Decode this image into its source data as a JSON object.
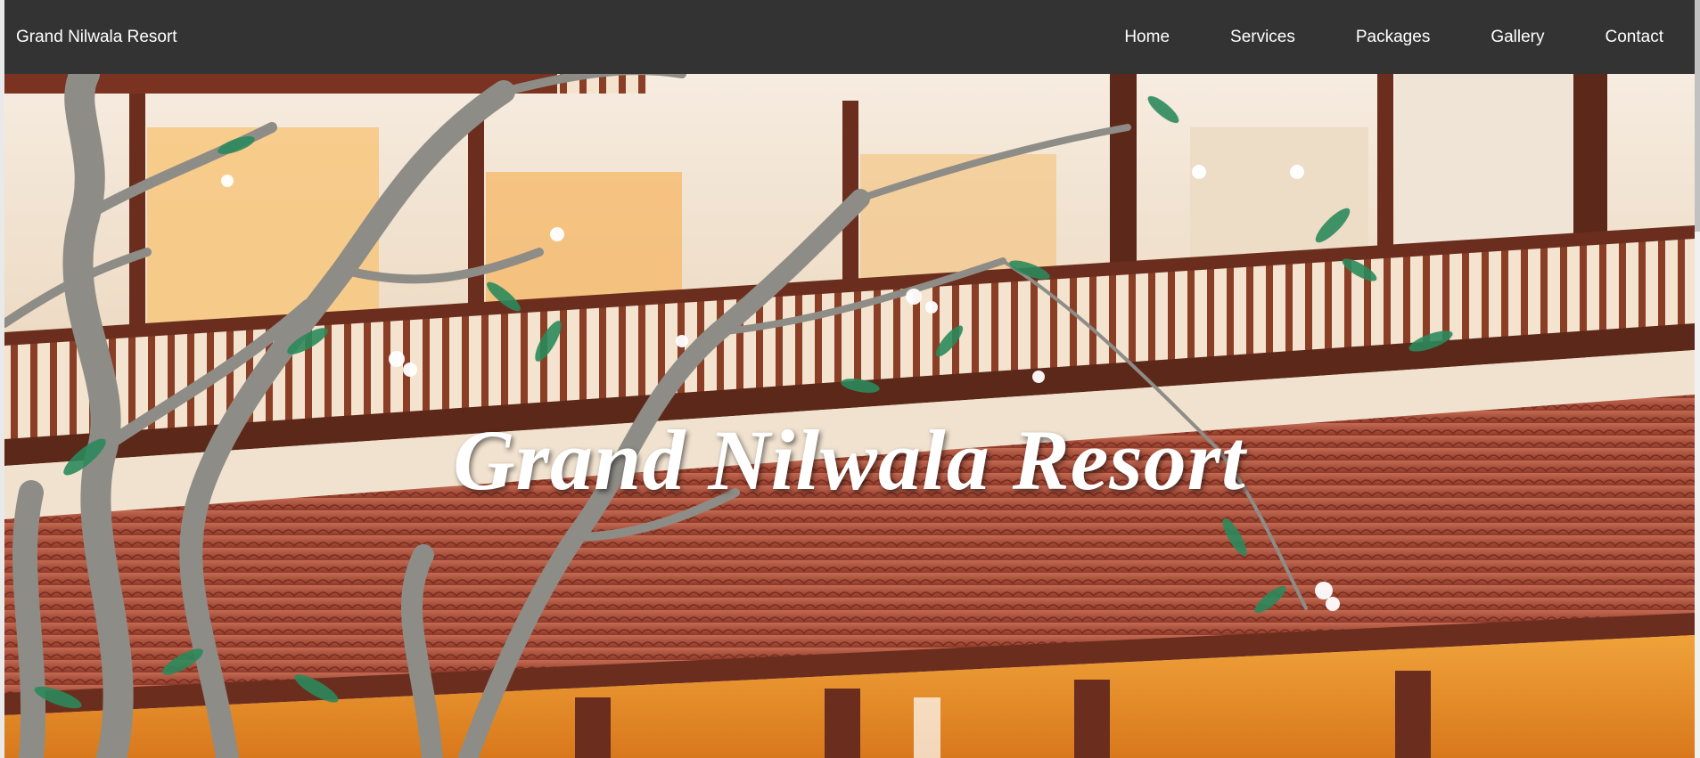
{
  "navbar": {
    "brand": "Grand Nilwala Resort",
    "links": [
      "Home",
      "Services",
      "Packages",
      "Gallery",
      "Contact"
    ]
  },
  "hero": {
    "title": "Grand Nilwala Resort"
  },
  "colors": {
    "navbar_bg": "#333333",
    "nav_text": "#ffffff",
    "roof": "#b0503c",
    "wood": "#6b2e1e",
    "wall": "#f3e6d6"
  }
}
